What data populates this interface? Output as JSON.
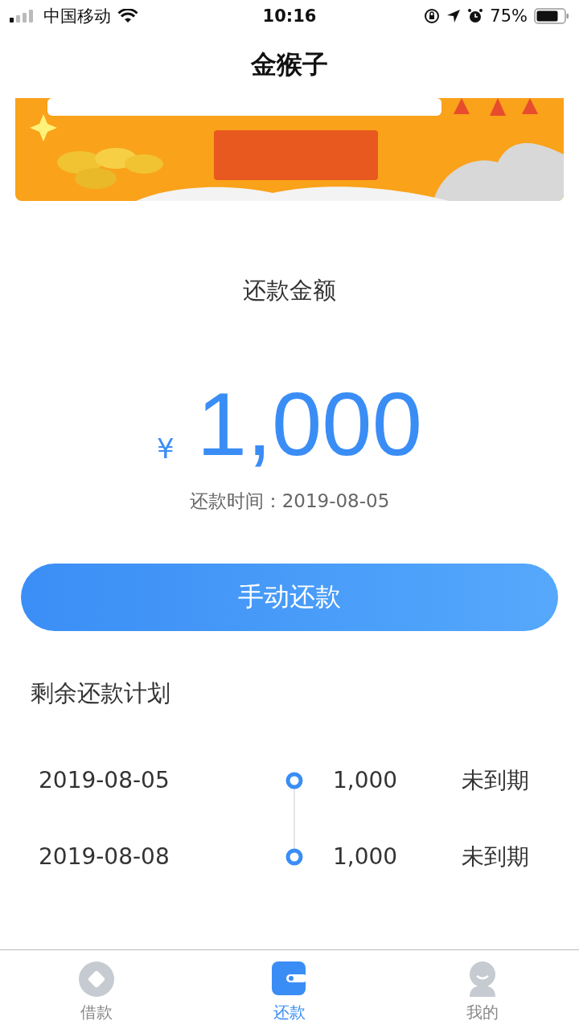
{
  "status_bar": {
    "carrier": "中国移动",
    "time": "10:16",
    "battery": "75%"
  },
  "nav": {
    "title": "金猴子"
  },
  "repayment": {
    "label": "还款金额",
    "currency": "¥",
    "amount": "1,000",
    "due": "还款时间：2019-08-05"
  },
  "button": "手动还款",
  "plan": {
    "title": "剩余还款计划",
    "rows": [
      {
        "date": "2019-08-05",
        "amount": "1,000",
        "status": "未到期"
      },
      {
        "date": "2019-08-08",
        "amount": "1,000",
        "status": "未到期"
      }
    ]
  },
  "tabs": [
    {
      "label": "借款",
      "selected": false
    },
    {
      "label": "还款",
      "selected": true
    },
    {
      "label": "我的",
      "selected": false
    }
  ]
}
